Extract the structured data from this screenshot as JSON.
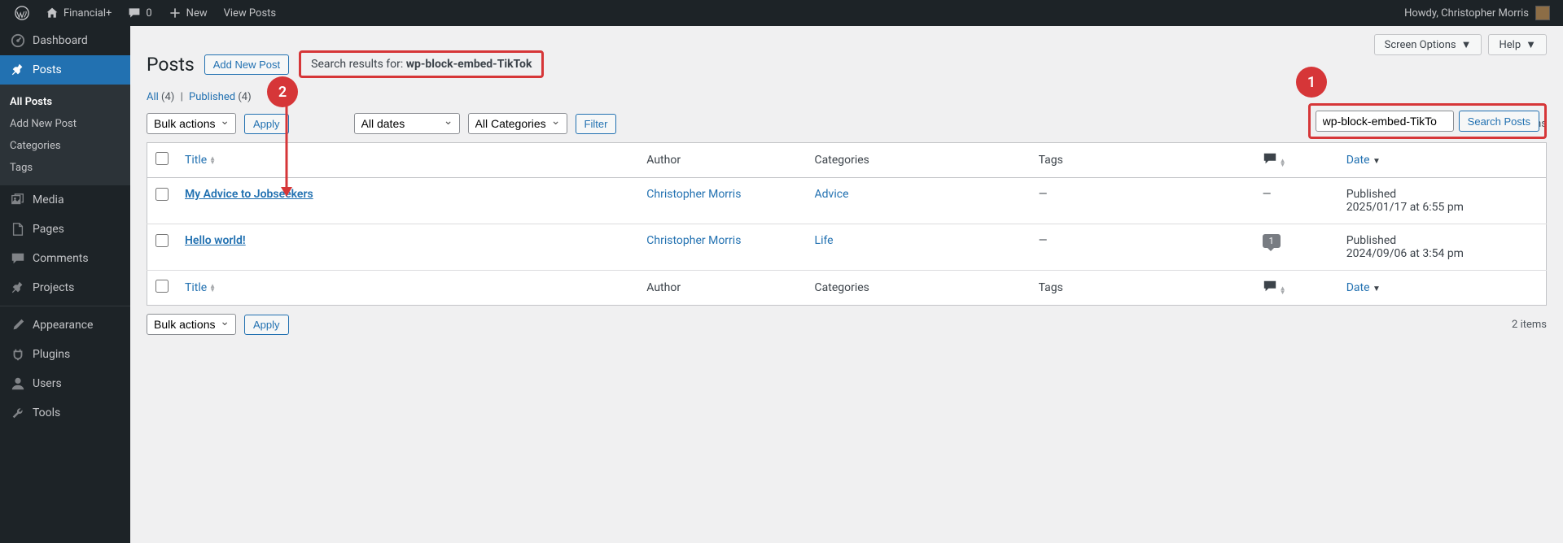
{
  "admin_bar": {
    "site_name": "Financial+",
    "comments_count": "0",
    "new_label": "New",
    "view_posts_label": "View Posts",
    "howdy": "Howdy, Christopher Morris"
  },
  "sidebar": {
    "items": [
      {
        "label": "Dashboard",
        "icon": "dashboard"
      },
      {
        "label": "Posts",
        "icon": "pin",
        "active": true
      },
      {
        "label": "Media",
        "icon": "media"
      },
      {
        "label": "Pages",
        "icon": "page"
      },
      {
        "label": "Comments",
        "icon": "comment"
      },
      {
        "label": "Projects",
        "icon": "pin"
      },
      {
        "label": "Appearance",
        "icon": "brush"
      },
      {
        "label": "Plugins",
        "icon": "plug"
      },
      {
        "label": "Users",
        "icon": "user"
      },
      {
        "label": "Tools",
        "icon": "wrench"
      }
    ],
    "submenu": [
      {
        "label": "All Posts",
        "active": true
      },
      {
        "label": "Add New Post"
      },
      {
        "label": "Categories"
      },
      {
        "label": "Tags"
      }
    ]
  },
  "top_buttons": {
    "screen_options": "Screen Options",
    "help": "Help"
  },
  "page": {
    "title": "Posts",
    "add_new": "Add New Post",
    "search_results_prefix": "Search results for: ",
    "search_results_query": "wp-block-embed-TikTok"
  },
  "subsubsub": {
    "all": "All",
    "all_count": "(4)",
    "published": "Published",
    "published_count": "(4)"
  },
  "filters": {
    "bulk_actions": "Bulk actions",
    "apply": "Apply",
    "all_dates": "All dates",
    "all_categories": "All Categories",
    "filter": "Filter"
  },
  "search": {
    "value": "wp-block-embed-TikTo",
    "button": "Search Posts"
  },
  "items_count": "2 items",
  "table": {
    "columns": {
      "title": "Title",
      "author": "Author",
      "categories": "Categories",
      "tags": "Tags",
      "date": "Date"
    },
    "rows": [
      {
        "title": "My Advice to Jobseekers",
        "author": "Christopher Morris",
        "category": "Advice",
        "tags": "—",
        "comments": "—",
        "date_status": "Published",
        "date_time": "2025/01/17 at 6:55 pm"
      },
      {
        "title": "Hello world!",
        "author": "Christopher Morris",
        "category": "Life",
        "tags": "—",
        "comments": "1",
        "date_status": "Published",
        "date_time": "2024/09/06 at 3:54 pm"
      }
    ]
  },
  "annotations": {
    "one": "1",
    "two": "2"
  }
}
